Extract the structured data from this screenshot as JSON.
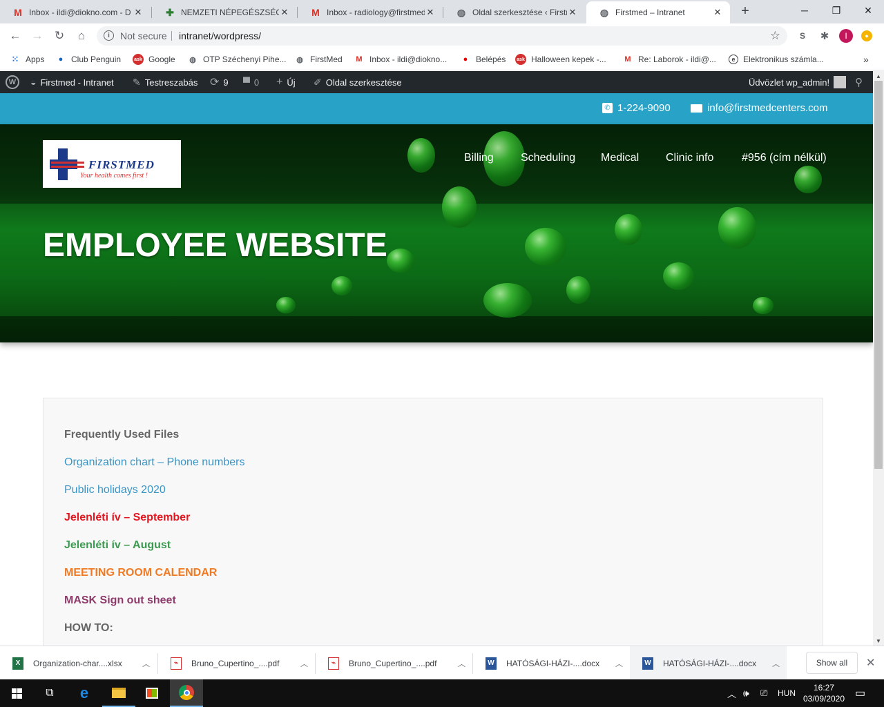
{
  "browser": {
    "tabs": [
      {
        "title": "Inbox - ildi@diokno.com - D",
        "icon": "gmail-icon"
      },
      {
        "title": "NEMZETI NÉPEGÉSZSÉGÜGYI",
        "icon": "nnk-icon"
      },
      {
        "title": "Inbox - radiology@firstmed",
        "icon": "gmail-icon"
      },
      {
        "title": "Oldal szerkesztése ‹ Firstme",
        "icon": "globe-icon"
      },
      {
        "title": "Firstmed – Intranet",
        "icon": "globe-icon"
      }
    ],
    "address": {
      "security_label": "Not secure",
      "url": "intranet/wordpress/"
    },
    "profile_initial": "I",
    "bookmarks": [
      {
        "label": "Apps",
        "icon": "apps-grid-icon"
      },
      {
        "label": "Club Penguin",
        "icon": "penguin-icon"
      },
      {
        "label": "Google",
        "icon": "ask-icon"
      },
      {
        "label": "OTP Széchenyi Pihe...",
        "icon": "globe-icon"
      },
      {
        "label": "FirstMed",
        "icon": "globe-icon"
      },
      {
        "label": "Inbox - ildi@diokno...",
        "icon": "gmail-icon"
      },
      {
        "label": "Belépés",
        "icon": "vodafone-icon"
      },
      {
        "label": "Halloween kepek -...",
        "icon": "ask-icon"
      },
      {
        "label": "Re: Laborok - ildi@...",
        "icon": "gmail-icon"
      },
      {
        "label": "Elektronikus számla...",
        "icon": "e-icon"
      }
    ]
  },
  "wp_admin": {
    "site_name": "Firstmed - Intranet",
    "customize": "Testreszabás",
    "updates_count": "9",
    "comments_count": "0",
    "new_label": "Új",
    "edit_page": "Oldal szerkesztése",
    "greeting": "Üdvözlet wp_admin!"
  },
  "site": {
    "phone": "1-224-9090",
    "email": "info@firstmedcenters.com",
    "logo_name": "FIRSTMED",
    "logo_tagline": "Your health comes first !",
    "nav": [
      "Billing",
      "Scheduling",
      "Medical",
      "Clinic info",
      "#956 (cím nélkül)"
    ],
    "hero_title": "EMPLOYEE WEBSITE"
  },
  "content": {
    "heading": "Frequently Used Files",
    "links": [
      {
        "text": "Organization chart – Phone numbers",
        "color": "#3a95c5"
      },
      {
        "text": "Public holidays 2020",
        "color": "#3a95c5"
      },
      {
        "text": "Jelenléti ív – September",
        "color": "#e3161f"
      },
      {
        "text": "Jelenléti ív – August",
        "color": "#3a9a50"
      },
      {
        "text": "MEETING ROOM CALENDAR",
        "color": "#f07a24"
      },
      {
        "text": "MASK Sign out sheet",
        "color": "#8e3b6b"
      }
    ],
    "howto": "HOW TO:"
  },
  "downloads": {
    "items": [
      {
        "name": "Organization-char....xlsx",
        "type": "xlsx"
      },
      {
        "name": "Bruno_Cupertino_....pdf",
        "type": "pdf"
      },
      {
        "name": "Bruno_Cupertino_....pdf",
        "type": "pdf"
      },
      {
        "name": "HATÓSÁGI-HÁZI-....docx",
        "type": "docx"
      },
      {
        "name": "HATÓSÁGI-HÁZI-....docx",
        "type": "docx"
      }
    ],
    "show_all": "Show all"
  },
  "taskbar": {
    "lang": "HUN",
    "time": "16:27",
    "date": "03/09/2020"
  }
}
